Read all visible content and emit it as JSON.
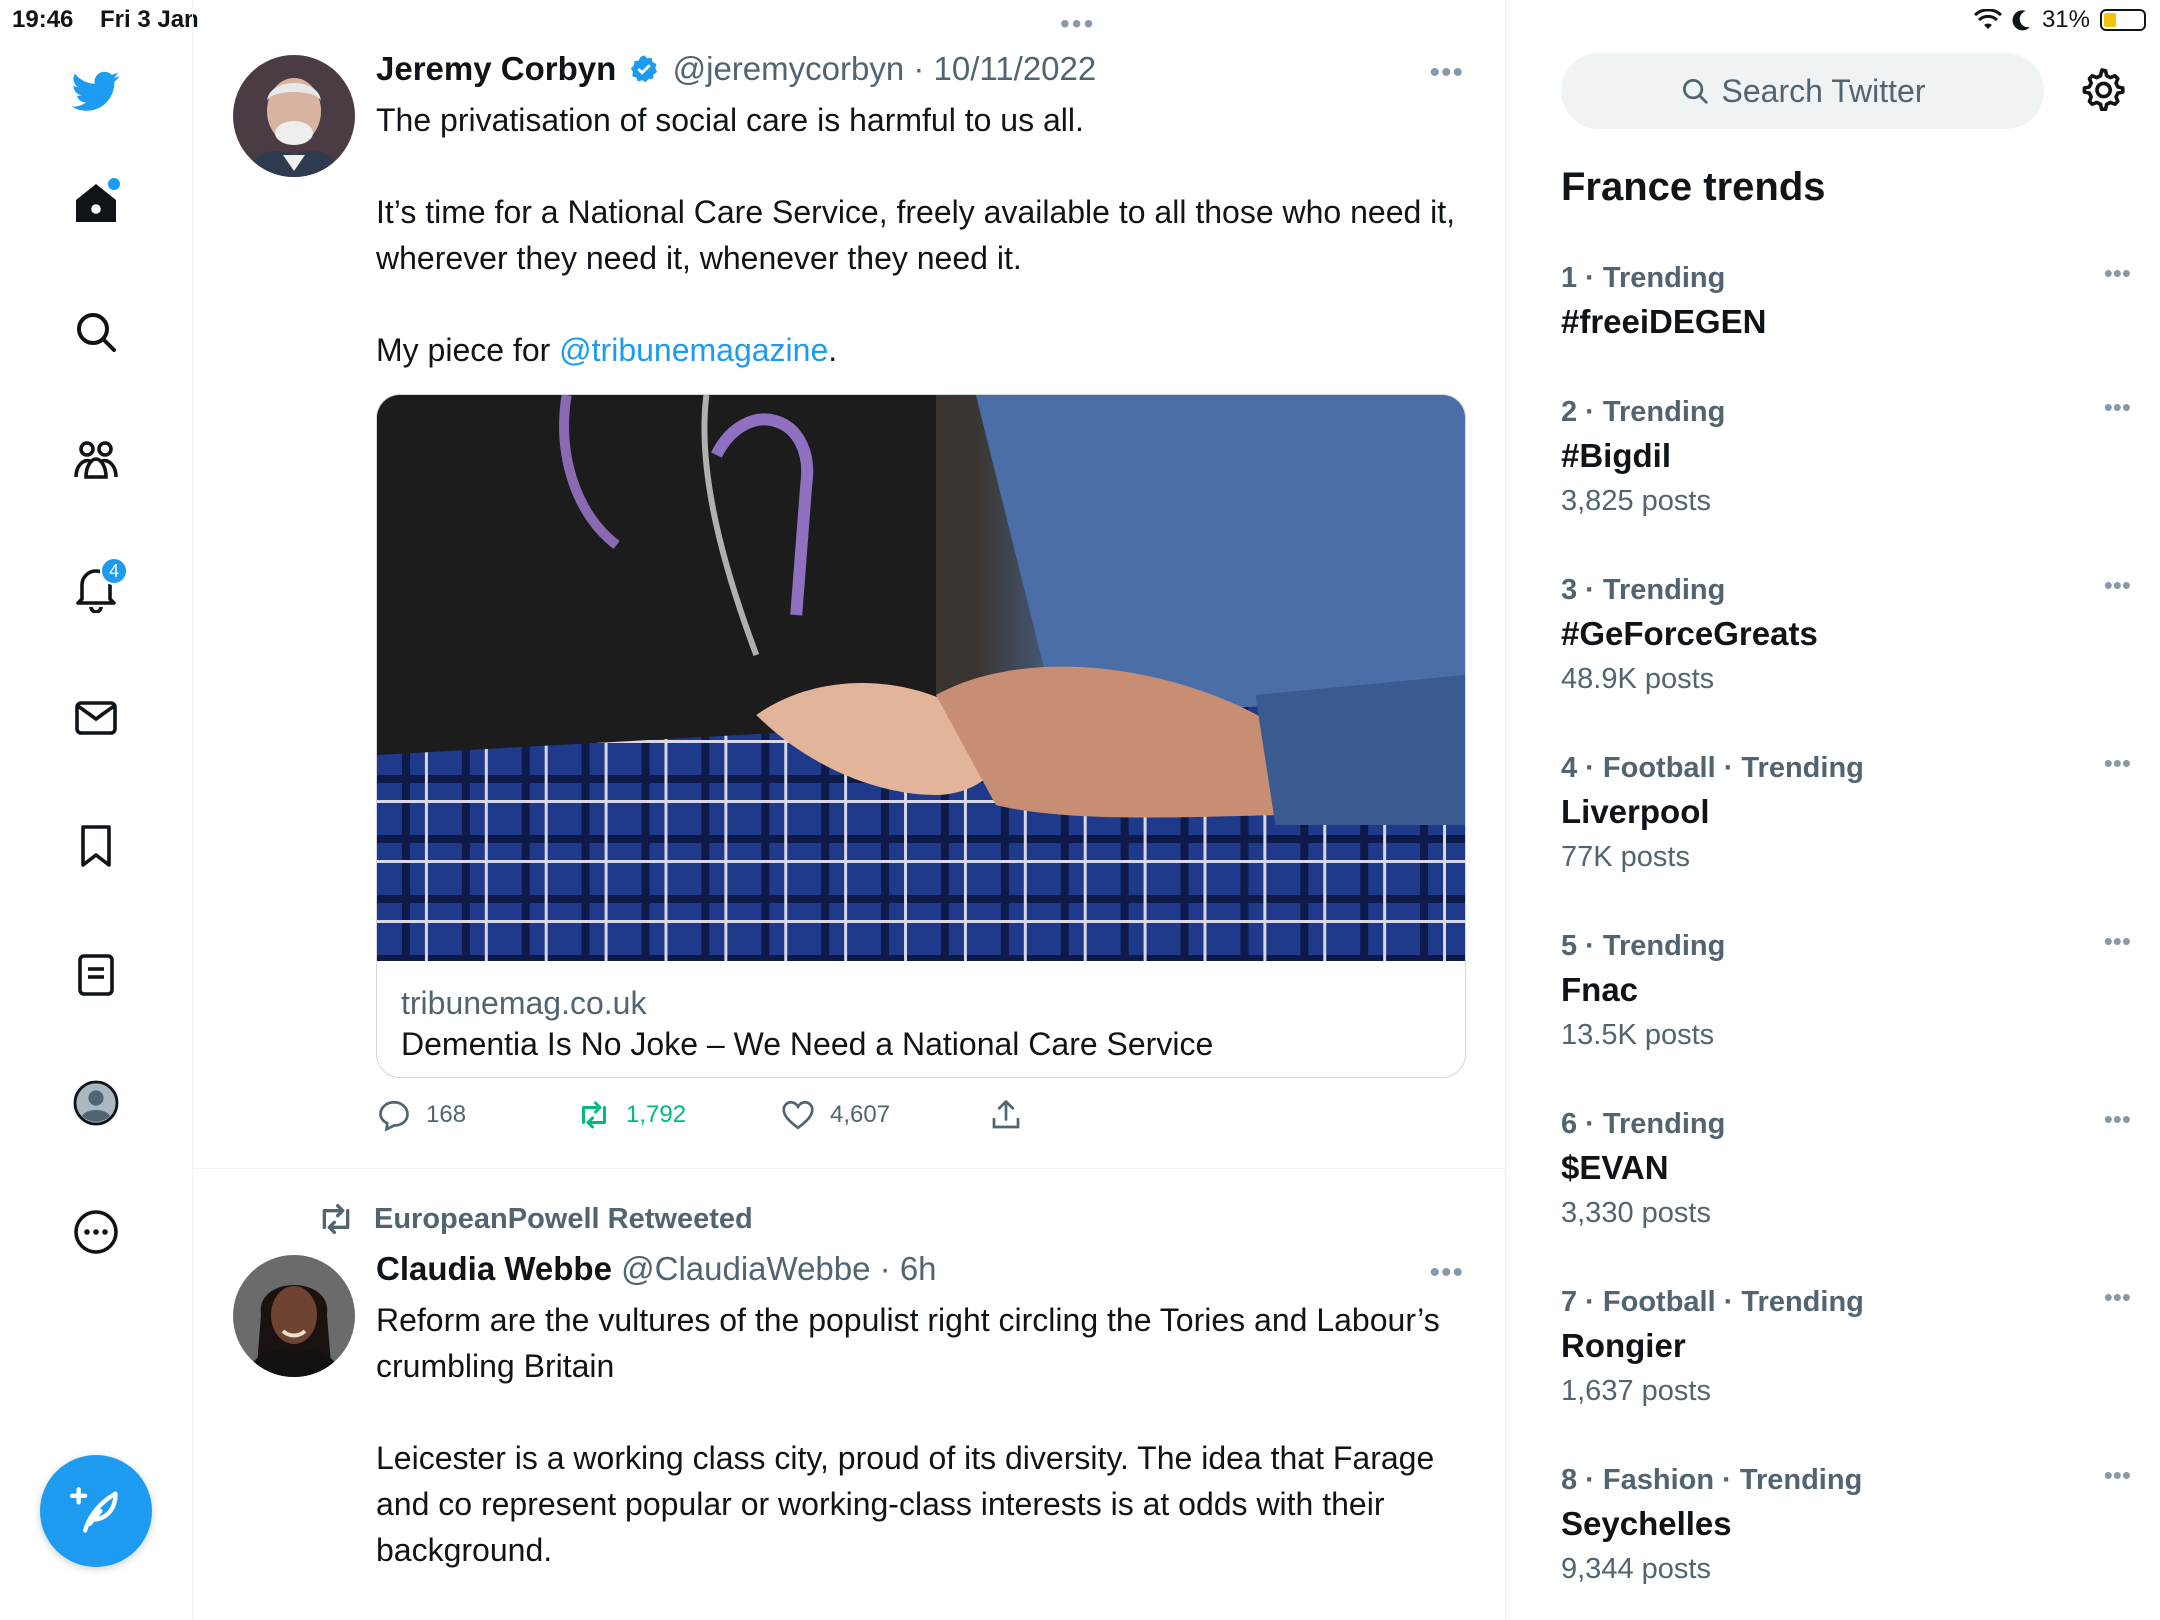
{
  "status_bar": {
    "time": "19:46",
    "date": "Fri 3 Jan",
    "battery": "31%",
    "battery_level": 0.31
  },
  "nav": {
    "notifications_count": "4"
  },
  "timeline": {
    "tweets": [
      {
        "name": "Jeremy Corbyn",
        "handle": "@jeremycorbyn",
        "date": "10/11/2022",
        "verified": true,
        "paragraphs": [
          "The privatisation of social care is harmful to us all.",
          "It’s time for a National Care Service, freely available to all those who need it, wherever they need it, whenever they need it."
        ],
        "piece_prefix": "My piece for ",
        "mention": "@tribunemagazine",
        "piece_suffix": ".",
        "card": {
          "domain": "tribunemag.co.uk",
          "title": "Dementia Is No Joke – We Need a National Care Service"
        },
        "replies": "168",
        "retweets": "1,792",
        "likes": "4,607"
      },
      {
        "retweeted_by": "EuropeanPowell Retweeted",
        "name": "Claudia Webbe",
        "handle": "@ClaudiaWebbe",
        "date": "6h",
        "paragraphs": [
          "Reform are the vultures of the populist right circling the Tories and Labour’s crumbling Britain",
          "Leicester is a working class city, proud of its diversity. The idea that Farage and co represent popular or working-class interests is at odds with their background."
        ]
      }
    ]
  },
  "sidebar": {
    "search_placeholder": "Search Twitter",
    "trends_title": "France trends",
    "trends": [
      {
        "context": "1 · Trending",
        "name": "#freeiDEGEN",
        "count": ""
      },
      {
        "context": "2 · Trending",
        "name": "#Bigdil",
        "count": "3,825 posts"
      },
      {
        "context": "3 · Trending",
        "name": "#GeForceGreats",
        "count": "48.9K posts"
      },
      {
        "context": "4 · Football · Trending",
        "name": "Liverpool",
        "count": "77K posts"
      },
      {
        "context": "5 · Trending",
        "name": "Fnac",
        "count": "13.5K posts"
      },
      {
        "context": "6 · Trending",
        "name": "$EVAN",
        "count": "3,330 posts"
      },
      {
        "context": "7 · Football · Trending",
        "name": "Rongier",
        "count": "1,637 posts"
      },
      {
        "context": "8 · Fashion · Trending",
        "name": "Seychelles",
        "count": "9,344 posts"
      }
    ]
  },
  "colors": {
    "accent": "#1d9bf0",
    "retweet_green": "#00ba7c",
    "secondary_text": "#536471"
  }
}
